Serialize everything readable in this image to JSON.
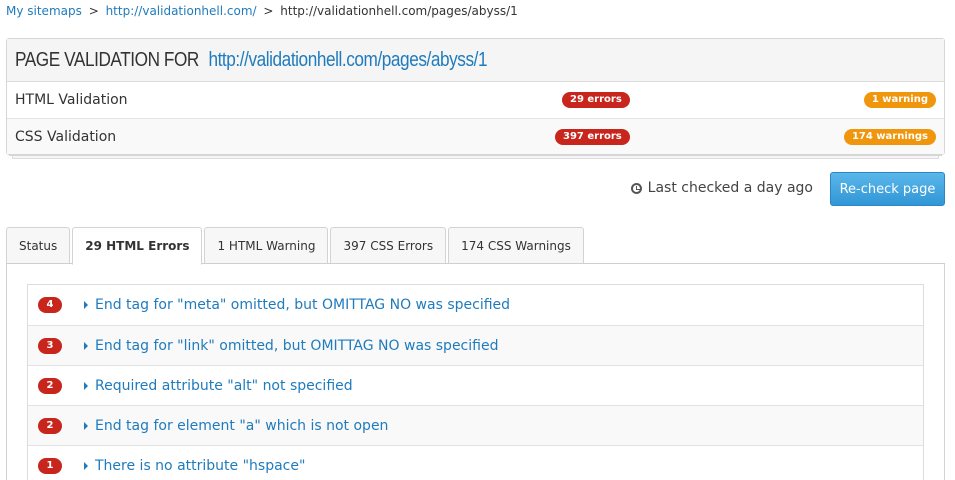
{
  "breadcrumb": {
    "items": [
      "My sitemaps",
      "http://validationhell.com/",
      "http://validationhell.com/pages/abyss/1"
    ],
    "separator": ">"
  },
  "panel": {
    "title": "PAGE VALIDATION FOR",
    "url": "http://validationhell.com/pages/abyss/1",
    "rows": [
      {
        "label": "HTML Validation",
        "errors": "29 errors",
        "warnings": "1 warning"
      },
      {
        "label": "CSS Validation",
        "errors": "397 errors",
        "warnings": "174 warnings"
      }
    ]
  },
  "status": {
    "last_checked": "Last checked a day ago",
    "recheck_label": "Re-check page"
  },
  "tabs": [
    {
      "label": "Status"
    },
    {
      "label": "29 HTML Errors",
      "active": true
    },
    {
      "label": "1 HTML Warning"
    },
    {
      "label": "397 CSS Errors"
    },
    {
      "label": "174 CSS Warnings"
    }
  ],
  "errors": [
    {
      "count": "4",
      "message": "End tag for \"meta\" omitted, but OMITTAG NO was specified"
    },
    {
      "count": "3",
      "message": "End tag for \"link\" omitted, but OMITTAG NO was specified"
    },
    {
      "count": "2",
      "message": "Required attribute \"alt\" not specified"
    },
    {
      "count": "2",
      "message": "End tag for element \"a\" which is not open"
    },
    {
      "count": "1",
      "message": "There is no attribute \"hspace\""
    }
  ],
  "colors": {
    "link": "#1f7bbd",
    "error_badge": "#c8261d",
    "warning_badge": "#f0960d",
    "button": "#3fa6e2"
  },
  "icons": {
    "clock": "clock-icon",
    "caret": "caret-right-icon"
  }
}
